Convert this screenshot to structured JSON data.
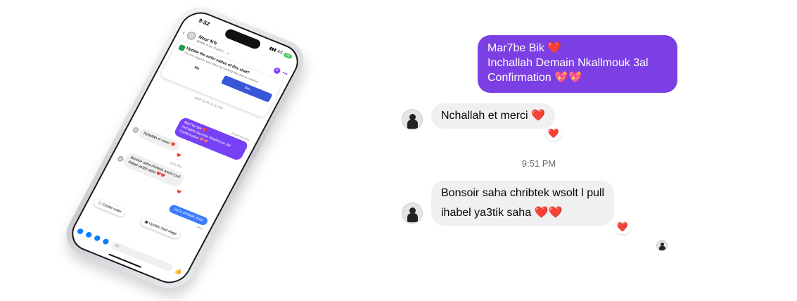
{
  "phone": {
    "status_time": "9:52",
    "status_network": "4G",
    "status_battery": "100",
    "contact_name": "Nour N'h",
    "contact_sub": "@isoke  m.ad_id:12021...  +1",
    "card_title": "Update the order status of this chat?",
    "card_desc": "You can organize your inbox by marking this chat as ordered.",
    "btn_no": "No",
    "btn_yes": "Yes",
    "date_label": "MAR 20 AT 11:33 PM",
    "sender_tag": "Zenedi Goudou",
    "out_line1": "Mar7be Bik ❤️",
    "out_line2": "Inchallah Demain Nkallmouk 3al",
    "out_line3": "Confirmation 💖💖",
    "in_msg1": "Nchallah et merci ❤️",
    "reaction1": "❤️",
    "time_label": "9:51 PM",
    "in_msg2_line1": "Bonsoir saha chribtek wsolt l pull",
    "in_msg2_line2": "ihabel ya3tik saha ❤️❤️",
    "reaction2": "❤️",
    "blue_msg": "Sa7a chribtek 3zizti",
    "sent_label": "Sent",
    "chip_create": "Create order",
    "chip_update": "Update lead stage",
    "input_placeholder": "Aa"
  },
  "chat": {
    "outgoing_line1": "Mar7be Bik",
    "outgoing_line1_emoji": "❤️",
    "outgoing_line2": "Inchallah Demain Nkallmouk 3al",
    "outgoing_line3": "Confirmation",
    "outgoing_line3_emoji": "💖💖",
    "incoming1": "Nchallah et merci",
    "incoming1_emoji": "❤️",
    "incoming1_reaction": "❤️",
    "timestamp": "9:51 PM",
    "incoming2_line1": "Bonsoir saha chribtek wsolt l pull",
    "incoming2_line2": "ihabel ya3tik saha",
    "incoming2_emoji": "❤️❤️",
    "incoming2_reaction": "❤️"
  },
  "colors": {
    "outgoing_bubble": "#7b3fe4",
    "incoming_bubble": "#f0f0f0",
    "heart": "#e0245e",
    "accent_blue": "#0a7cff"
  }
}
